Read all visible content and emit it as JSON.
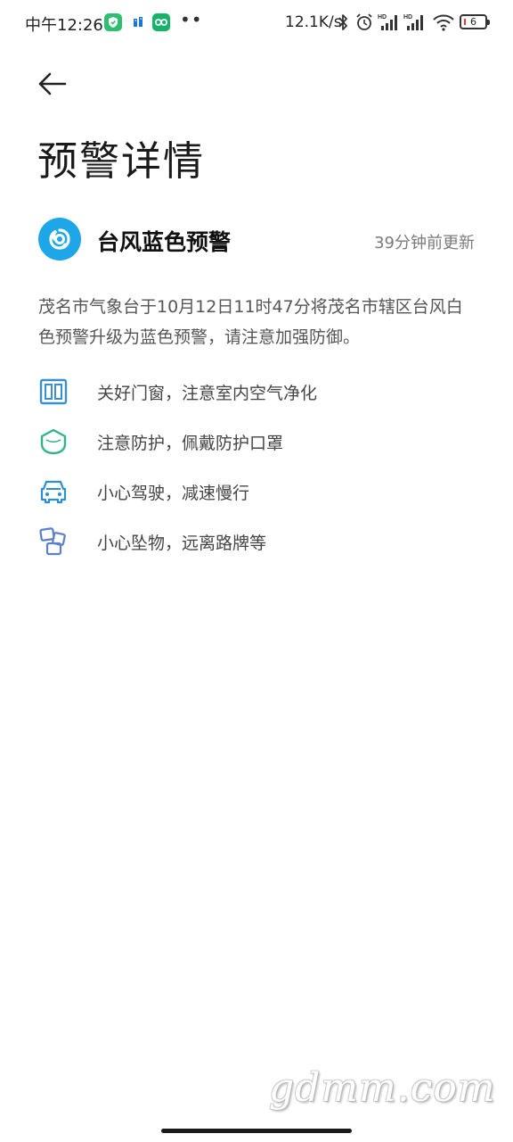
{
  "status_bar": {
    "time": "中午12:26",
    "net_speed": "12.1K/s",
    "battery_level": "6",
    "icons": [
      "shield-app-icon",
      "app-icon",
      "infinity-app-icon",
      "more-dots",
      "bluetooth-icon",
      "alarm-icon",
      "signal-hd-icon",
      "signal-hd-icon",
      "wifi-icon",
      "battery-icon"
    ],
    "more": "••"
  },
  "header": {
    "back_icon": "arrow-left-icon",
    "title": "预警详情"
  },
  "alert": {
    "icon": "typhoon-icon",
    "icon_color": "#1ea7e8",
    "title": "台风蓝色预警",
    "update_time": "39分钟前更新",
    "description": "茂名市气象台于10月12日11时47分将茂名市辖区台风白色预警升级为蓝色预警，请注意加强防御。"
  },
  "suggestions": [
    {
      "icon": "window-icon",
      "text": "关好门窗，注意室内空气净化",
      "color": "#3a8fd0"
    },
    {
      "icon": "mask-icon",
      "text": "注意防护，佩戴防护口罩",
      "color": "#33b38a"
    },
    {
      "icon": "car-icon",
      "text": "小心驾驶，减速慢行",
      "color": "#2b8fd6"
    },
    {
      "icon": "falling-objects-icon",
      "text": "小心坠物，远离路牌等",
      "color": "#5b7fc9"
    }
  ],
  "watermark": "gdmm.com"
}
